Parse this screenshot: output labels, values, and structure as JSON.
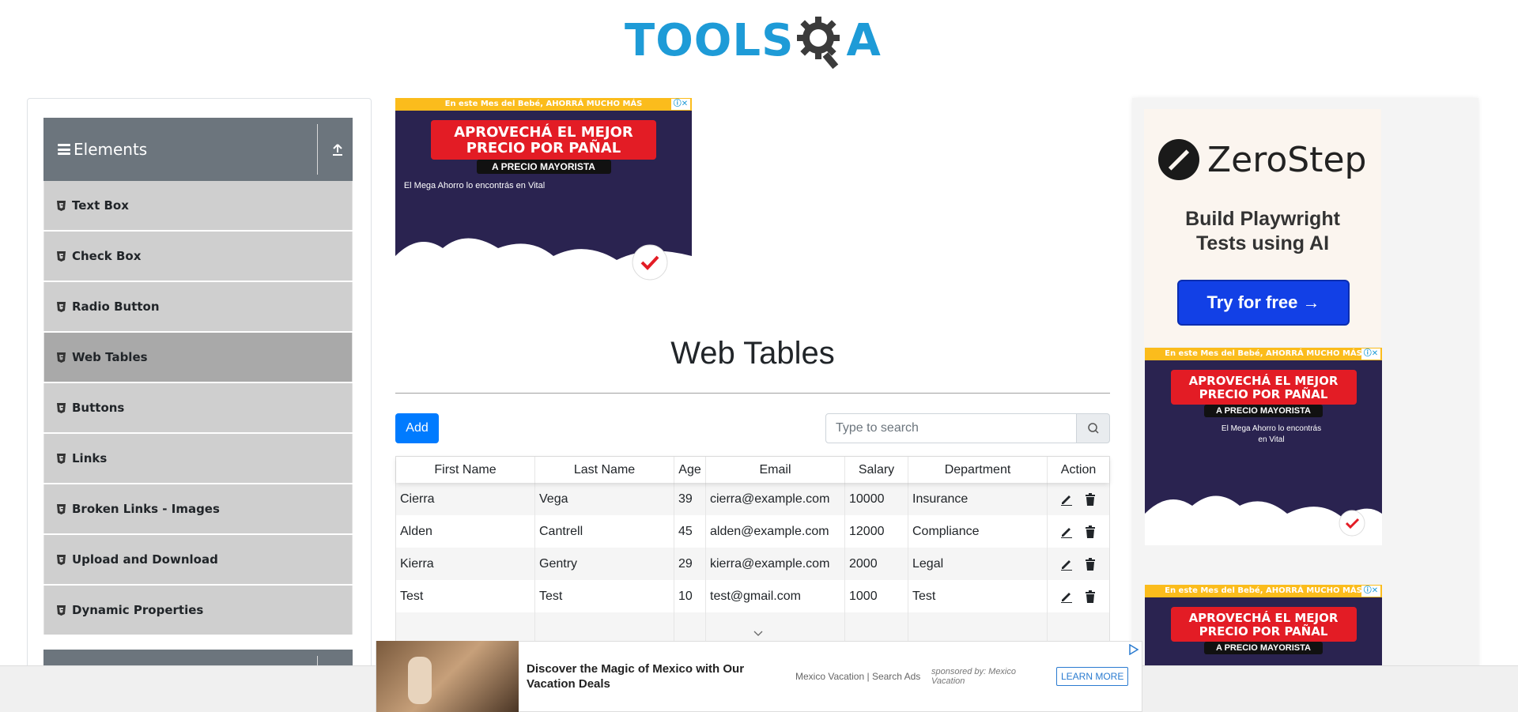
{
  "header": {
    "logo_part1": "TOOLS",
    "logo_part2": "A"
  },
  "sidebar": {
    "group_title": "Elements",
    "items": [
      {
        "label": "Text Box"
      },
      {
        "label": "Check Box"
      },
      {
        "label": "Radio Button"
      },
      {
        "label": "Web Tables",
        "active": true
      },
      {
        "label": "Buttons"
      },
      {
        "label": "Links"
      },
      {
        "label": "Broken Links - Images"
      },
      {
        "label": "Upload and Download"
      },
      {
        "label": "Dynamic Properties"
      }
    ]
  },
  "ad_center": {
    "strip": "En este Mes del Bebé, AHORRÁ MUCHO MÁS",
    "headline": "APROVECHÁ EL MEJOR PRECIO POR PAÑAL",
    "sub_badge": "A PRECIO MAYORISTA",
    "body": "El Mega Ahorro lo encontrás en Vital"
  },
  "main": {
    "title": "Web Tables",
    "add_label": "Add",
    "search_placeholder": "Type to search"
  },
  "table": {
    "headers": [
      "First Name",
      "Last Name",
      "Age",
      "Email",
      "Salary",
      "Department",
      "Action"
    ],
    "rows": [
      [
        "Cierra",
        "Vega",
        "39",
        "cierra@example.com",
        "10000",
        "Insurance"
      ],
      [
        "Alden",
        "Cantrell",
        "45",
        "alden@example.com",
        "12000",
        "Compliance"
      ],
      [
        "Kierra",
        "Gentry",
        "29",
        "kierra@example.com",
        "2000",
        "Legal"
      ],
      [
        "Test",
        "Test",
        "10",
        "test@gmail.com",
        "1000",
        "Test"
      ]
    ]
  },
  "ad_right": {
    "brand": "ZeroStep",
    "tagline_1": "Build Playwright",
    "tagline_2": "Tests using AI",
    "cta": "Try for free →"
  },
  "bottom_ad": {
    "headline": "Discover the Magic of Mexico with Our Vacation Deals",
    "source": "Mexico Vacation | Search Ads",
    "sponsor": "sponsored by: Mexico Vacation",
    "cta": "LEARN MORE"
  },
  "colors": {
    "brand_blue": "#1e9bd7",
    "primary": "#007bff",
    "sidebar_header": "#6c757d",
    "sidebar_item": "#cfcfcf",
    "sidebar_active": "#a9a9a9"
  }
}
